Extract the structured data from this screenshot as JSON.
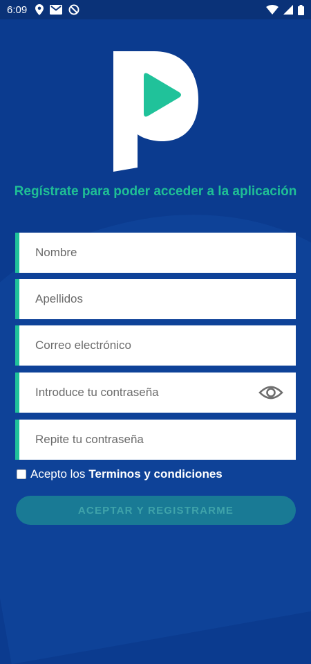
{
  "status_bar": {
    "time": "6:09",
    "left_icons": [
      "location-icon",
      "mail-icon",
      "do-not-disturb-icon"
    ],
    "right_icons": [
      "wifi-icon",
      "signal-icon",
      "battery-icon"
    ]
  },
  "logo": {
    "icon": "play-p-logo-icon"
  },
  "headline": "Regístrate para poder acceder a la aplicación",
  "form": {
    "nombre_placeholder": "Nombre",
    "apellidos_placeholder": "Apellidos",
    "correo_placeholder": "Correo electrónico",
    "password_placeholder": "Introduce tu contraseña",
    "repeat_password_placeholder": "Repite tu contraseña",
    "password_toggle_icon": "eye-icon"
  },
  "terms": {
    "checked": false,
    "prefix": "Acepto los",
    "link": "Terminos y condiciones"
  },
  "submit_label": "ACEPTAR Y REGISTRARME",
  "colors": {
    "background": "#0b3b8f",
    "accent": "#1fbf95",
    "button": "#197a95"
  }
}
